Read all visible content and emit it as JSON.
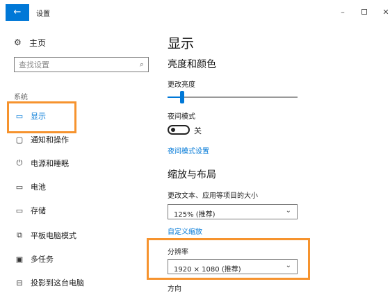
{
  "window": {
    "back_icon": "arrow-left-icon",
    "title": "设置",
    "minimize_glyph": "–",
    "close_glyph": "✕",
    "accent": "#0078d7",
    "highlight": "#f6932e"
  },
  "sidebar": {
    "home_label": "主页",
    "search_placeholder": "查找设置",
    "section_label": "系统",
    "items": [
      {
        "label": "显示",
        "icon": "monitor-icon",
        "active": true
      },
      {
        "label": "通知和操作",
        "icon": "notification-icon",
        "active": false
      },
      {
        "label": "电源和睡眠",
        "icon": "power-icon",
        "active": false
      },
      {
        "label": "电池",
        "icon": "battery-icon",
        "active": false
      },
      {
        "label": "存储",
        "icon": "storage-icon",
        "active": false
      },
      {
        "label": "平板电脑模式",
        "icon": "tablet-mode-icon",
        "active": false
      },
      {
        "label": "多任务",
        "icon": "multitask-icon",
        "active": false
      },
      {
        "label": "投影到这台电脑",
        "icon": "project-icon",
        "active": false
      }
    ]
  },
  "content": {
    "page_title": "显示",
    "brightness_section": "亮度和颜色",
    "brightness_label": "更改亮度",
    "brightness_level": 0.11,
    "night_light_label": "夜间模式",
    "night_light_state": "关",
    "night_light_link": "夜间模式设置",
    "scale_section": "缩放与布局",
    "scale_label": "更改文本、应用等项目的大小",
    "scale_value": "125% (推荐)",
    "custom_scale_link": "自定义缩放",
    "resolution_label": "分辨率",
    "resolution_value": "1920 × 1080 (推荐)",
    "orientation_label": "方向"
  }
}
